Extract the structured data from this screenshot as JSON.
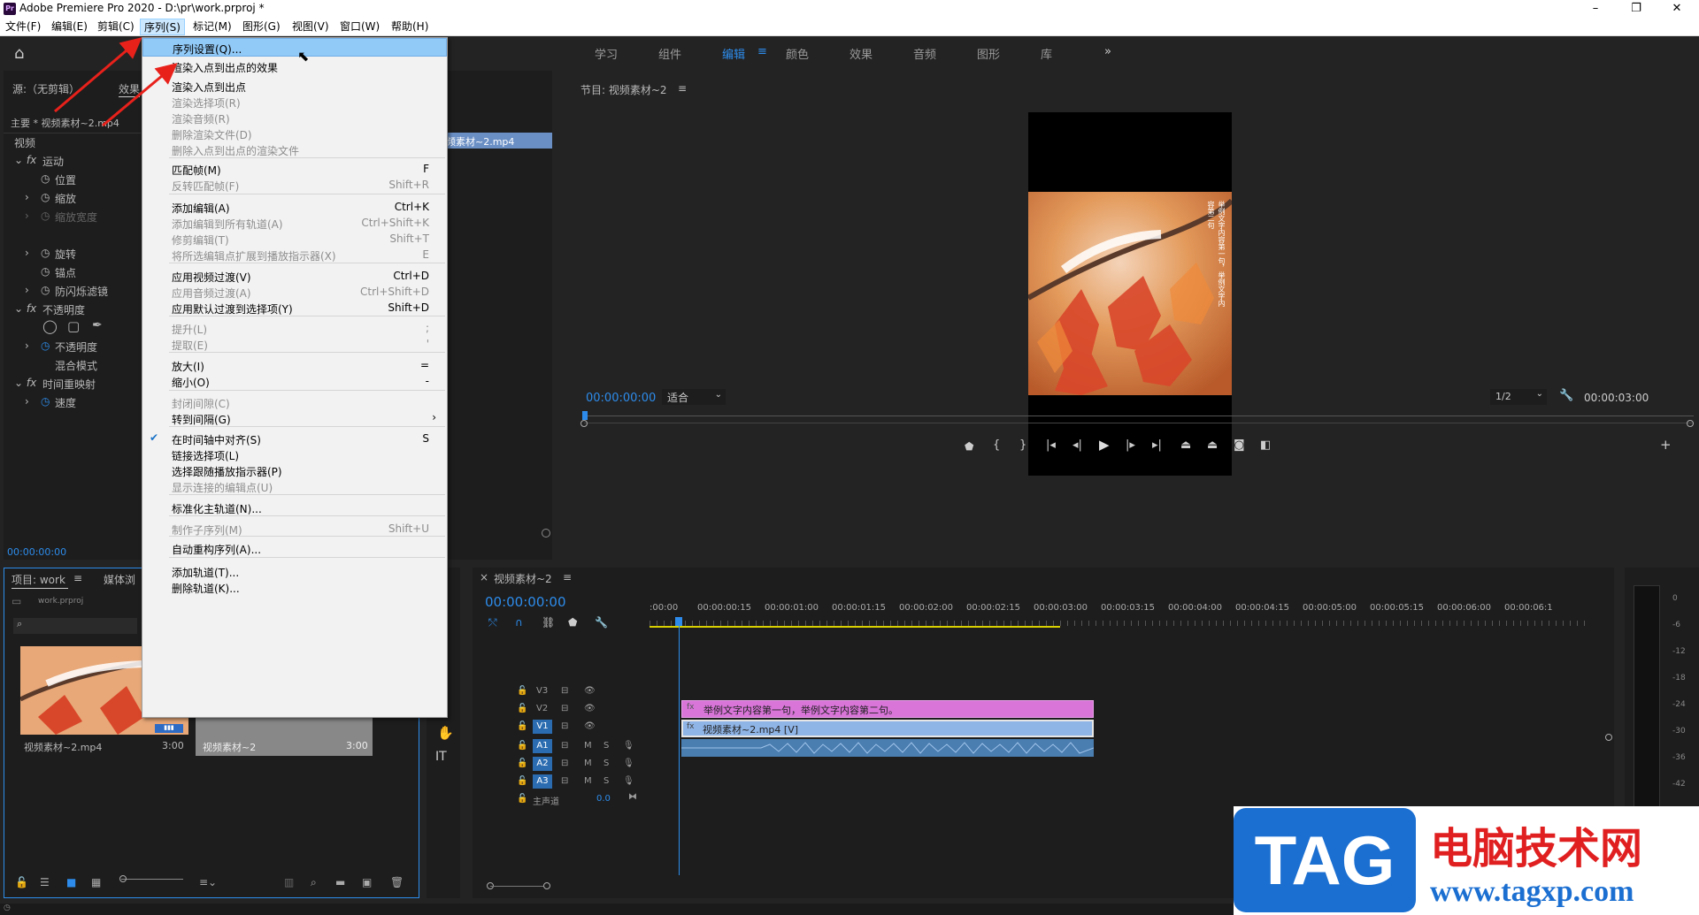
{
  "window": {
    "title": "Adobe Premiere Pro 2020 - D:\\pr\\work.prproj *",
    "logo": "Pr"
  },
  "menubar": [
    {
      "label": "文件(F)"
    },
    {
      "label": "编辑(E)"
    },
    {
      "label": "剪辑(C)"
    },
    {
      "label": "序列(S)"
    },
    {
      "label": "标记(M)"
    },
    {
      "label": "图形(G)"
    },
    {
      "label": "视图(V)"
    },
    {
      "label": "窗口(W)"
    },
    {
      "label": "帮助(H)"
    }
  ],
  "workspaces": [
    "学习",
    "组件",
    "编辑",
    "颜色",
    "效果",
    "音频",
    "图形",
    "库"
  ],
  "source_panel": {
    "tab_source": "源:（无剪辑）",
    "tab_effects": "效果",
    "master": "主要 * 视频素材~2.mp4",
    "timecode": "00:00:00:00",
    "clip_chip": "频素材~2.mp4"
  },
  "effects": [
    {
      "label": "视频"
    },
    {
      "label": "运动"
    },
    {
      "label": "位置"
    },
    {
      "label": "缩放"
    },
    {
      "label": "缩放宽度"
    },
    {
      "label": "旋转"
    },
    {
      "label": "锚点"
    },
    {
      "label": "防闪烁滤镜"
    },
    {
      "label": "不透明度"
    },
    {
      "label": "不透明度"
    },
    {
      "label": "混合模式"
    },
    {
      "label": "时间重映射"
    },
    {
      "label": "速度"
    }
  ],
  "program": {
    "title": "节目: 视频素材~2",
    "timecode": "00:00:00:00",
    "fit": "适合",
    "resolution": "1/2",
    "duration": "00:00:03:00",
    "overlay_text": "举例文字内容第一句，举例文字内容第二句"
  },
  "project": {
    "tab_project": "项目: work",
    "tab_media": "媒体浏",
    "file": "work.prproj",
    "item1_name": "视频素材~2.mp4",
    "item1_dur": "3:00",
    "item2_name": "视频素材~2",
    "item2_dur": "3:00"
  },
  "menu": {
    "items": [
      {
        "label": "序列设置(Q)...",
        "shortcut": "",
        "state": "hl"
      },
      {
        "label": "渲染入点到出点的效果",
        "shortcut": "",
        "state": ""
      },
      {
        "label": "渲染入点到出点",
        "shortcut": "",
        "state": ""
      },
      {
        "label": "渲染选择项(R)",
        "shortcut": "",
        "state": "dis"
      },
      {
        "label": "渲染音频(R)",
        "shortcut": "",
        "state": "dis"
      },
      {
        "label": "删除渲染文件(D)",
        "shortcut": "",
        "state": "dis"
      },
      {
        "label": "删除入点到出点的渲染文件",
        "shortcut": "",
        "state": "dis"
      },
      {
        "label": "匹配帧(M)",
        "shortcut": "F",
        "state": ""
      },
      {
        "label": "反转匹配帧(F)",
        "shortcut": "Shift+R",
        "state": "dis"
      },
      {
        "label": "添加编辑(A)",
        "shortcut": "Ctrl+K",
        "state": ""
      },
      {
        "label": "添加编辑到所有轨道(A)",
        "shortcut": "Ctrl+Shift+K",
        "state": "dis"
      },
      {
        "label": "修剪编辑(T)",
        "shortcut": "Shift+T",
        "state": "dis"
      },
      {
        "label": "将所选编辑点扩展到播放指示器(X)",
        "shortcut": "E",
        "state": "dis"
      },
      {
        "label": "应用视频过渡(V)",
        "shortcut": "Ctrl+D",
        "state": ""
      },
      {
        "label": "应用音频过渡(A)",
        "shortcut": "Ctrl+Shift+D",
        "state": "dis"
      },
      {
        "label": "应用默认过渡到选择项(Y)",
        "shortcut": "Shift+D",
        "state": ""
      },
      {
        "label": "提升(L)",
        "shortcut": ";",
        "state": "dis"
      },
      {
        "label": "提取(E)",
        "shortcut": "'",
        "state": "dis"
      },
      {
        "label": "放大(I)",
        "shortcut": "=",
        "state": ""
      },
      {
        "label": "缩小(O)",
        "shortcut": "-",
        "state": ""
      },
      {
        "label": "封闭间隙(C)",
        "shortcut": "",
        "state": "dis"
      },
      {
        "label": "转到间隔(G)",
        "shortcut": "",
        "state": "sub"
      },
      {
        "label": "在时间轴中对齐(S)",
        "shortcut": "S",
        "state": "chk"
      },
      {
        "label": "链接选择项(L)",
        "shortcut": "",
        "state": ""
      },
      {
        "label": "选择跟随播放指示器(P)",
        "shortcut": "",
        "state": ""
      },
      {
        "label": "显示连接的编辑点(U)",
        "shortcut": "",
        "state": "dis"
      },
      {
        "label": "标准化主轨道(N)...",
        "shortcut": "",
        "state": ""
      },
      {
        "label": "制作子序列(M)",
        "shortcut": "Shift+U",
        "state": "dis"
      },
      {
        "label": "自动重构序列(A)...",
        "shortcut": "",
        "state": ""
      },
      {
        "label": "添加轨道(T)...",
        "shortcut": "",
        "state": ""
      },
      {
        "label": "删除轨道(K)...",
        "shortcut": "",
        "state": ""
      }
    ]
  },
  "timeline": {
    "title": "视频素材~2",
    "timecode": "00:00:00:00",
    "ruler": [
      ":00:00",
      "00:00:00:15",
      "00:00:01:00",
      "00:00:01:15",
      "00:00:02:00",
      "00:00:02:15",
      "00:00:03:00",
      "00:00:03:15",
      "00:00:04:00",
      "00:00:04:15",
      "00:00:05:00",
      "00:00:05:15",
      "00:00:06:00",
      "00:00:06:1"
    ],
    "tracks": [
      "V3",
      "V2",
      "V1",
      "A1",
      "A2",
      "A3"
    ],
    "master": "主声道",
    "master_val": "0.0",
    "clip_v2": "举例文字内容第一句，举例文字内容第二句。",
    "clip_v1": "视频素材~2.mp4 [V]"
  },
  "meter_ticks": [
    "0",
    "-6",
    "-12",
    "-18",
    "-24",
    "-30",
    "-36",
    "-42"
  ],
  "watermark": {
    "tag": "TAG",
    "cn": "电脑技术网",
    "url": "www.tagxp.com"
  },
  "colors": {
    "accent": "#2d8ceb",
    "pink_clip": "#d975d9",
    "video_clip": "#8fb4e6",
    "audio_clip": "#4a7db0"
  }
}
